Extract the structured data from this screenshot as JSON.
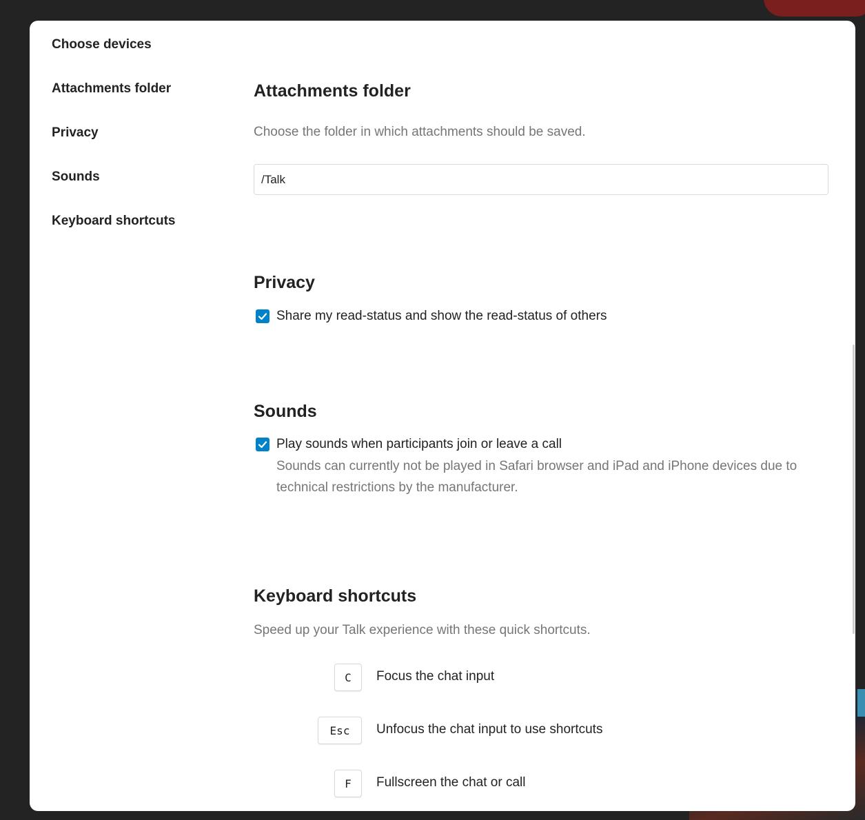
{
  "nav": {
    "items": [
      {
        "label": "Choose devices"
      },
      {
        "label": "Attachments folder"
      },
      {
        "label": "Privacy"
      },
      {
        "label": "Sounds"
      },
      {
        "label": "Keyboard shortcuts"
      }
    ]
  },
  "attachments": {
    "title": "Attachments folder",
    "description": "Choose the folder in which attachments should be saved.",
    "folder_value": "/Talk"
  },
  "privacy": {
    "title": "Privacy",
    "read_status_label": "Share my read-status and show the read-status of others",
    "read_status_checked": true
  },
  "sounds": {
    "title": "Sounds",
    "play_sounds_label": "Play sounds when participants join or leave a call",
    "play_sounds_checked": true,
    "hint": "Sounds can currently not be played in Safari browser and iPad and iPhone devices due to technical restrictions by the manufacturer."
  },
  "shortcuts": {
    "title": "Keyboard shortcuts",
    "description": "Speed up your Talk experience with these quick shortcuts.",
    "items": [
      {
        "key": "C",
        "label": "Focus the chat input"
      },
      {
        "key": "Esc",
        "label": "Unfocus the chat input to use shortcuts"
      },
      {
        "key": "F",
        "label": "Fullscreen the chat or call"
      }
    ]
  },
  "colors": {
    "accent": "#0082c9",
    "text": "#222222",
    "muted": "#767676"
  }
}
